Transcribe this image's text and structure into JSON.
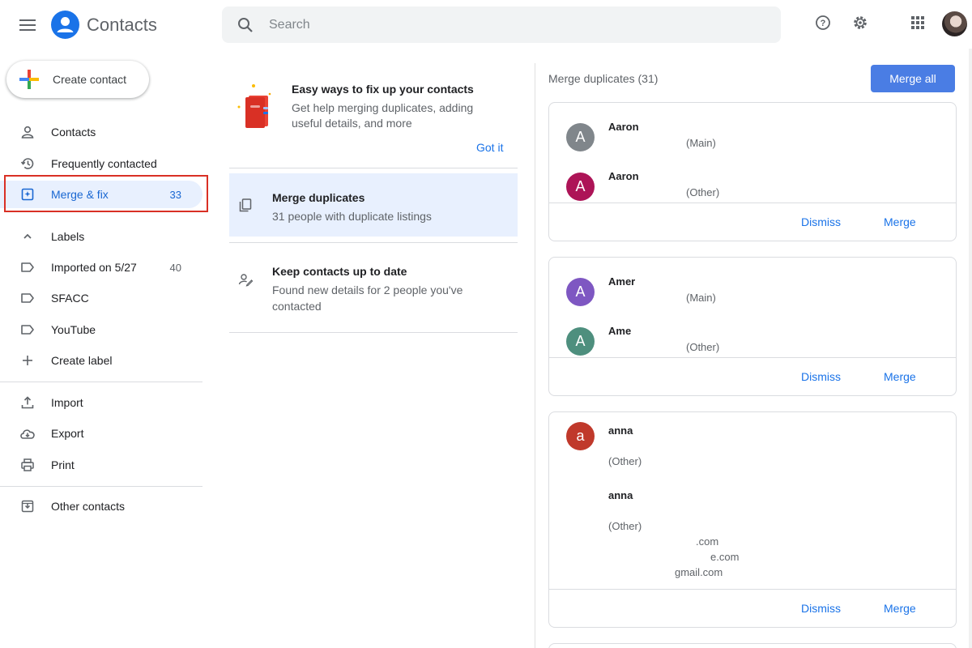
{
  "header": {
    "app_title": "Contacts",
    "search_placeholder": "Search",
    "icons": [
      "menu-icon",
      "contacts-logo-icon",
      "search-icon",
      "help-icon",
      "gear-icon",
      "apps-grid-icon"
    ]
  },
  "sidebar": {
    "create_label": "Create contact",
    "items": [
      {
        "label": "Contacts",
        "icon": "person-icon"
      },
      {
        "label": "Frequently contacted",
        "icon": "history-icon"
      },
      {
        "label": "Merge & fix",
        "icon": "merge-fix-icon",
        "count": "33",
        "active": true
      }
    ],
    "labels_heading": "Labels",
    "labels": [
      {
        "label": "Imported on 5/27",
        "count": "40"
      },
      {
        "label": "SFACC"
      },
      {
        "label": "YouTube"
      }
    ],
    "create_label_label": "Create label",
    "actions": [
      {
        "label": "Import",
        "icon": "upload-icon"
      },
      {
        "label": "Export",
        "icon": "cloud-download-icon"
      },
      {
        "label": "Print",
        "icon": "printer-icon"
      }
    ],
    "other_contacts": "Other contacts",
    "colors": {
      "active_bg": "#e8f0fe",
      "active_text": "#1967d2",
      "highlight": "#d93025"
    }
  },
  "middle": {
    "tip": {
      "title": "Easy ways to fix up your contacts",
      "desc": "Get help merging duplicates, adding useful details, and more",
      "got_it": "Got it"
    },
    "merge_item": {
      "title": "Merge duplicates",
      "desc": "31 people with duplicate listings"
    },
    "keep_item": {
      "title": "Keep contacts up to date",
      "desc": "Found new details for 2 people you've contacted"
    }
  },
  "right": {
    "heading": "Merge duplicates (31)",
    "merge_all": "Merge all",
    "dismiss": "Dismiss",
    "merge": "Merge",
    "cards": [
      {
        "contacts": [
          {
            "initial": "A",
            "name": "Aaron",
            "sub": "(Main)",
            "color": "#80868b"
          },
          {
            "initial": "A",
            "name": "Aaron",
            "sub": "(Other)",
            "color": "#ad1457"
          }
        ]
      },
      {
        "contacts": [
          {
            "initial": "A",
            "name": "Amer",
            "sub": "(Main)",
            "color": "#7e57c2"
          },
          {
            "initial": "A",
            "name": "Ame",
            "sub": "(Other)",
            "color": "#4e8f7e"
          }
        ]
      },
      {
        "contacts": [
          {
            "initial": "a",
            "name": "anna",
            "sub": "(Other)",
            "color": "#c0392b"
          },
          {
            "name": "anna",
            "sub": "(Other)",
            "emails": [
              ".com",
              "e.com",
              "gmail.com"
            ]
          }
        ]
      }
    ]
  }
}
